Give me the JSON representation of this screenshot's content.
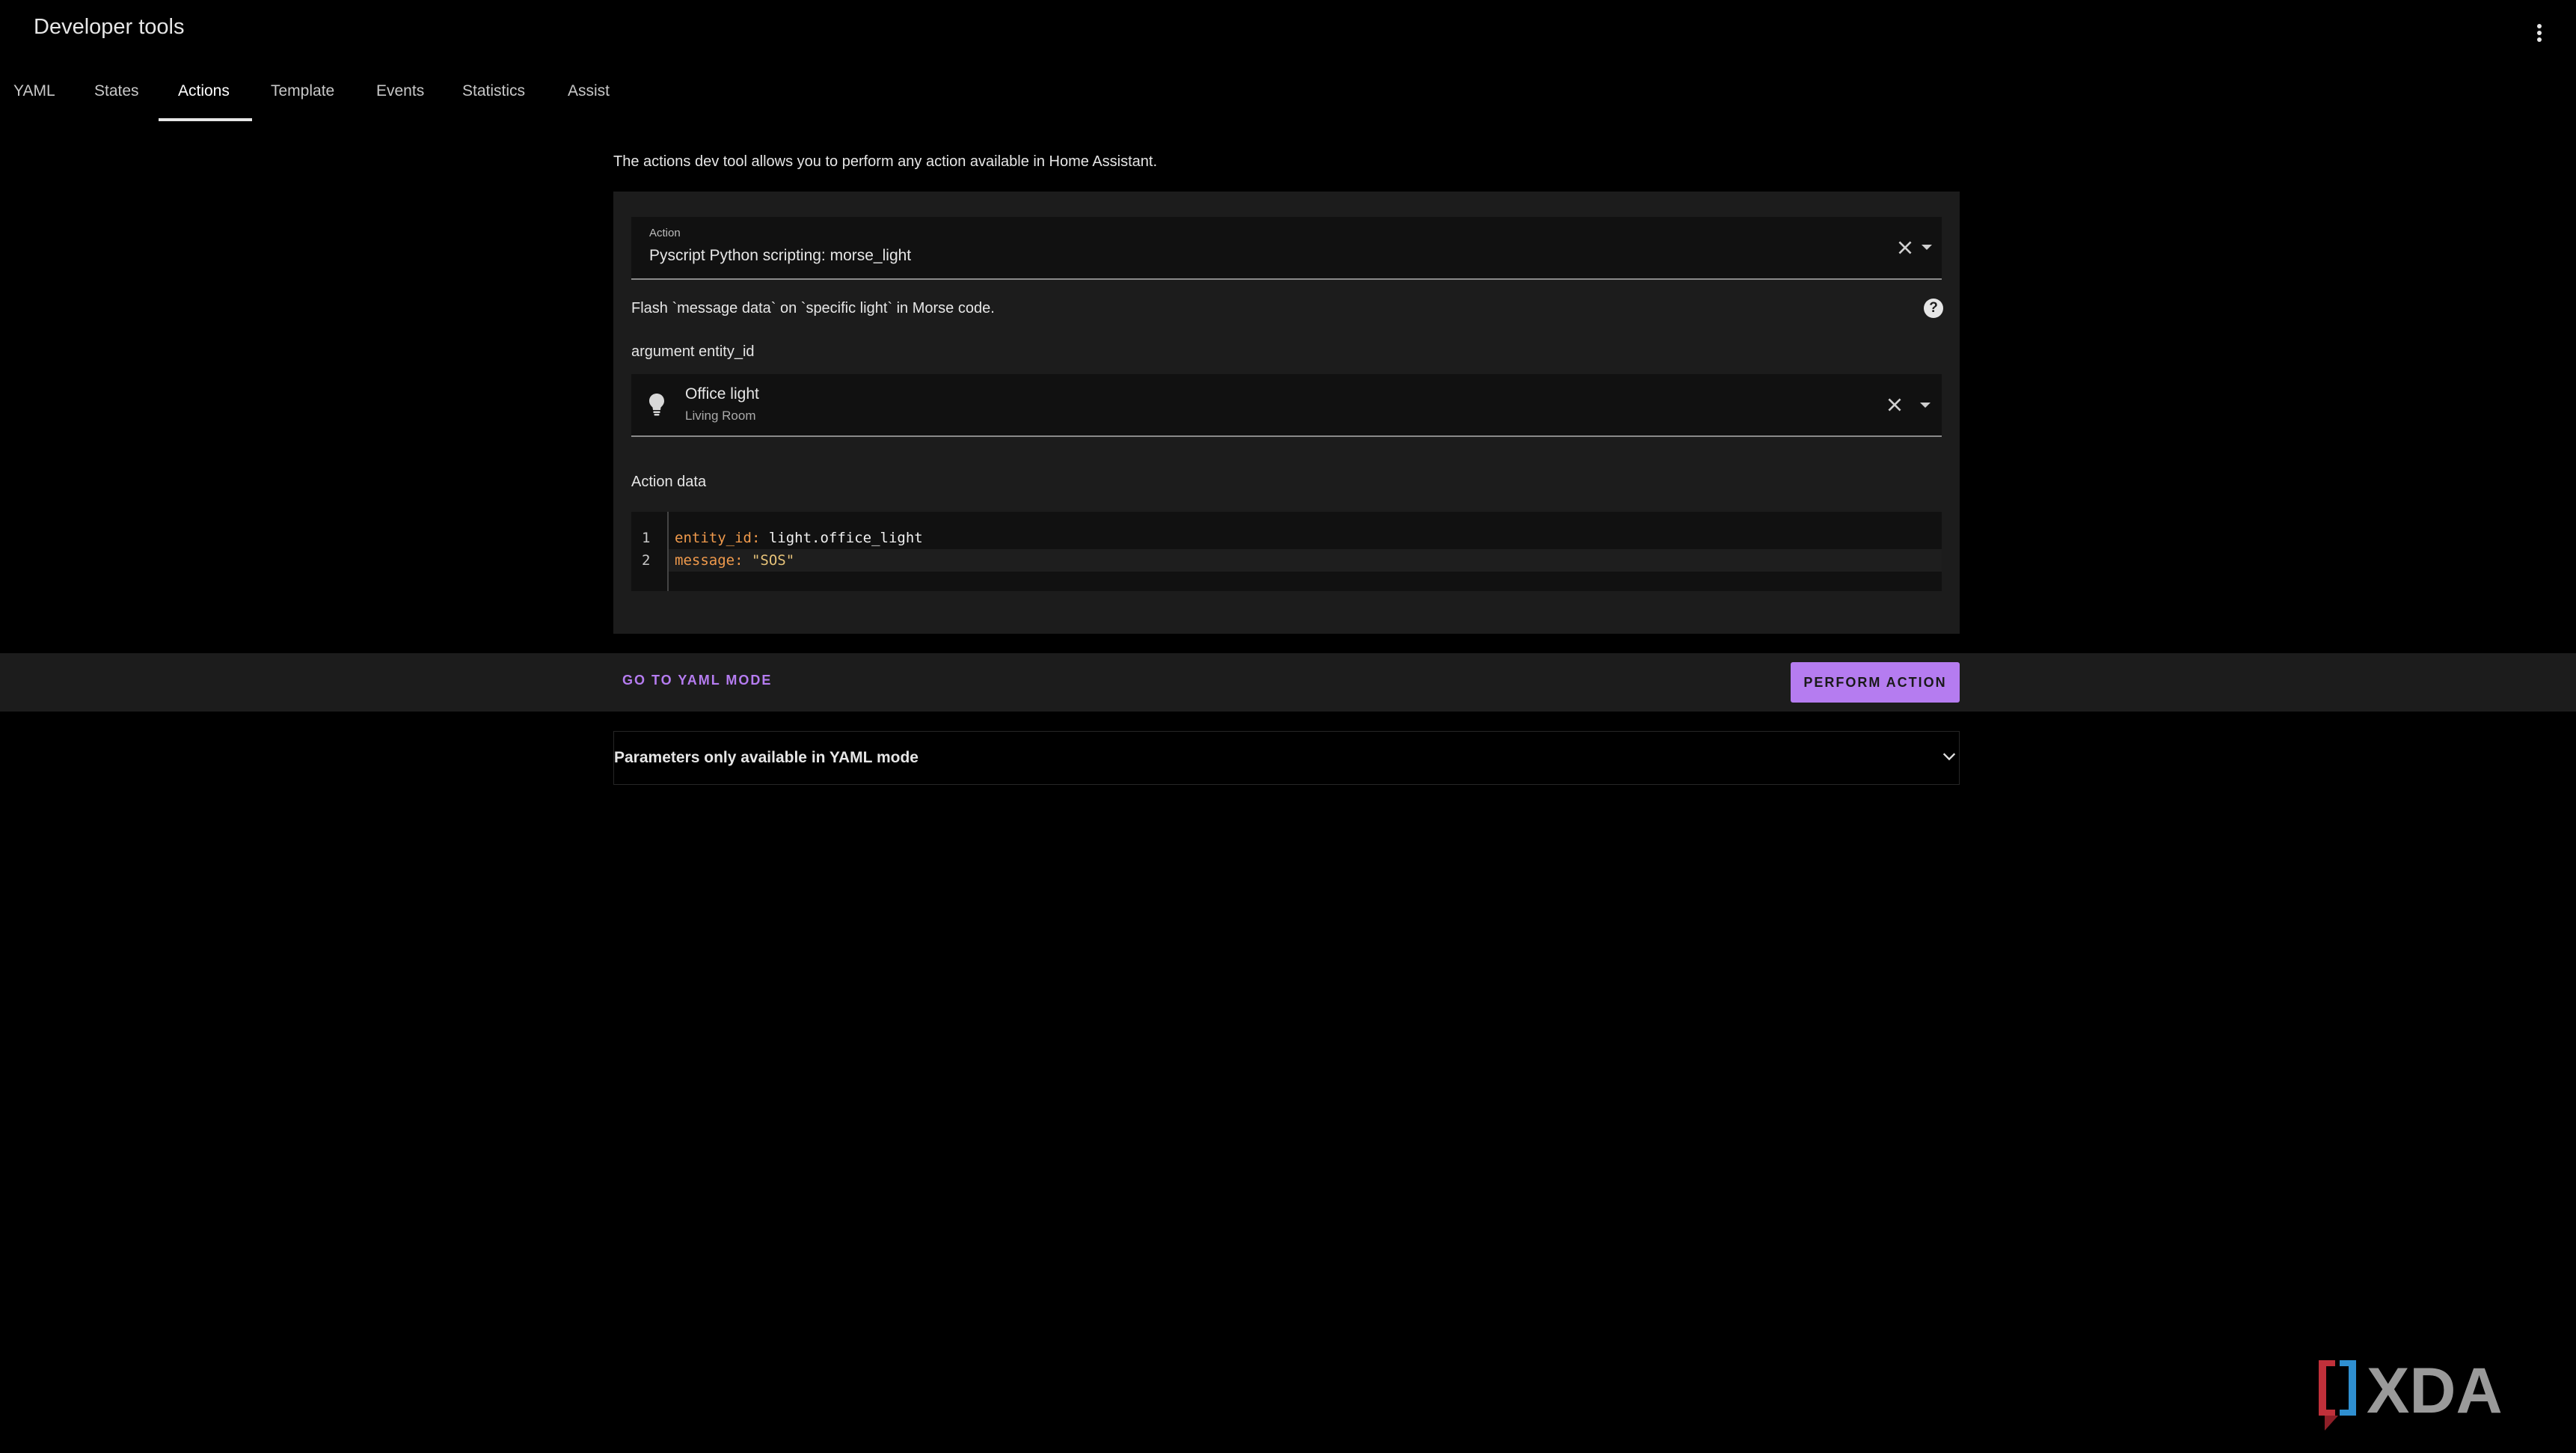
{
  "header": {
    "title": "Developer tools"
  },
  "tabs": [
    {
      "label": "YAML"
    },
    {
      "label": "States"
    },
    {
      "label": "Actions",
      "active": true
    },
    {
      "label": "Template"
    },
    {
      "label": "Events"
    },
    {
      "label": "Statistics"
    },
    {
      "label": "Assist"
    }
  ],
  "main": {
    "intro": "The actions dev tool allows you to perform any action available in Home Assistant.",
    "action_field": {
      "label": "Action",
      "value": "Pyscript Python scripting: morse_light"
    },
    "description": "Flash `message data` on `specific light` in Morse code.",
    "argument_label": "argument entity_id",
    "entity": {
      "name": "Office light",
      "area": "Living Room",
      "icon": "lightbulb-icon"
    },
    "action_data_label": "Action data",
    "editor": {
      "lines": [
        {
          "number": "1",
          "key": "entity_id:",
          "value": "light.office_light"
        },
        {
          "number": "2",
          "key": "message:",
          "value": "\"SOS\""
        }
      ]
    }
  },
  "actions": {
    "yaml_mode_label": "GO TO YAML MODE",
    "perform_label": "PERFORM ACTION"
  },
  "params": {
    "label": "Parameters only available in YAML mode"
  },
  "watermark": {
    "text": "XDA"
  },
  "colors": {
    "accent": "#b57cf0",
    "background": "#000000",
    "card": "#1c1c1c",
    "yaml_key": "#f09a4c"
  }
}
